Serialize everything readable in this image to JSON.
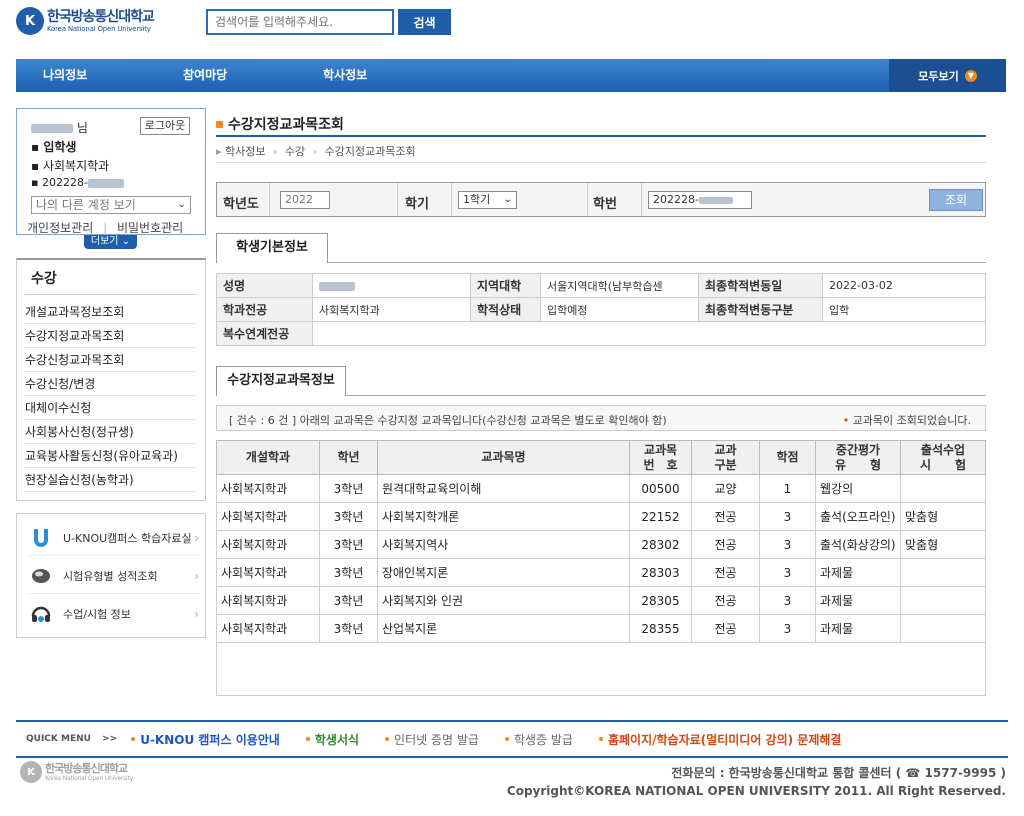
{
  "header": {
    "logo_mark": "K",
    "logo_kr": "한국방송통신대학교",
    "logo_en": "Korea National Open University",
    "search_placeholder": "검색어를 입력해주세요.",
    "search_button": "검색"
  },
  "nav": {
    "items": [
      "나의정보",
      "참여마당",
      "학사정보"
    ],
    "all_label": "모두보기"
  },
  "user": {
    "name_suffix": "님",
    "logout": "로그아웃",
    "status": "입학생",
    "department": "사회복지학과",
    "student_id_prefix": "202228-",
    "account_select": "나의 다른 계정 보기",
    "link_info": "개인정보관리",
    "link_divider": "|",
    "link_password": "비밀번호관리",
    "more": "더보기"
  },
  "sidemenu": {
    "title": "수강",
    "items": [
      "개설교과목정보조회",
      "수강지정교과목조회",
      "수강신청교과목조회",
      "수강신청/변경",
      "대체이수신청",
      "사회봉사신청(정규생)",
      "교육봉사활동신청(유아교육과)",
      "현장실습신청(농학과)"
    ]
  },
  "quicklinks": {
    "items": [
      "U-KNOU캠퍼스 학습자료실",
      "시험유형별 성적조회",
      "수업/시험 정보"
    ]
  },
  "content": {
    "title": "수강지정교과목조회",
    "breadcrumb": [
      "학사정보",
      "수강",
      "수강지정교과목조회"
    ],
    "search": {
      "year_label": "학년도",
      "year_value": "2022",
      "semester_label": "학기",
      "semester_value": "1학기",
      "id_label": "학번",
      "id_value": "202228-",
      "button": "조회"
    },
    "info_tab": "학생기본정보",
    "info": {
      "name_label": "성명",
      "region_label": "지역대학",
      "region_value": "서울지역대학(남부학습센",
      "last_change_date_label": "최종학적변동일",
      "last_change_date_value": "2022-03-02",
      "major_label": "학과전공",
      "major_value": "사회복지학과",
      "status_label": "학적상태",
      "status_value": "입학예정",
      "last_change_type_label": "최종학적변동구분",
      "last_change_type_value": "입학",
      "double_major_label": "복수연계전공"
    },
    "course_tab": "수강지정교과목정보",
    "notice_left": "[ 건수 : 6 건 ] 아래의 교과목은 수강지정 교과목입니다(수강신청 교과목은 별도로 확인해야 함)",
    "notice_right": "교과목이 조회되었습니다.",
    "table": {
      "headers": [
        "개설학과",
        "학년",
        "교과목명",
        "교과목\n번　호",
        "교과\n구분",
        "학점",
        "중간평가\n유　　형",
        "출석수업\n시　　험"
      ],
      "rows": [
        [
          "사회복지학과",
          "3학년",
          "원격대학교육의이해",
          "00500",
          "교양",
          "1",
          "웹강의",
          ""
        ],
        [
          "사회복지학과",
          "3학년",
          "사회복지학개론",
          "22152",
          "전공",
          "3",
          "출석(오프라인)",
          "맞춤형"
        ],
        [
          "사회복지학과",
          "3학년",
          "사회복지역사",
          "28302",
          "전공",
          "3",
          "출석(화상강의)",
          "맞춤형"
        ],
        [
          "사회복지학과",
          "3학년",
          "장애인복지론",
          "28303",
          "전공",
          "3",
          "과제물",
          ""
        ],
        [
          "사회복지학과",
          "3학년",
          "사회복지와 인권",
          "28305",
          "전공",
          "3",
          "과제물",
          ""
        ],
        [
          "사회복지학과",
          "3학년",
          "산업복지론",
          "28355",
          "전공",
          "3",
          "과제물",
          ""
        ]
      ]
    }
  },
  "footer": {
    "quickmenu_label": "QUICK MENU",
    "quickmenu_arrow": ">>",
    "links": [
      "U-KNOU 캠퍼스 이용안내",
      "학생서식",
      "인터넷 증명 발급",
      "학생증 발급",
      "홈페이지/학습자료(멀티미디어 강의) 문제해결"
    ],
    "contact": "전화문의 : 한국방송통신대학교 통합 콜센터 ( ☎ 1577-9995 )",
    "copyright": "Copyright©KOREA NATIONAL OPEN UNIVERSITY 2011. All Right Reserved."
  },
  "colors": {
    "primary": "#1f5ea8",
    "accent": "#f08a1c",
    "link_blue": "#1a56c4",
    "link_green": "#2e8b2e",
    "link_red": "#d04a12"
  }
}
